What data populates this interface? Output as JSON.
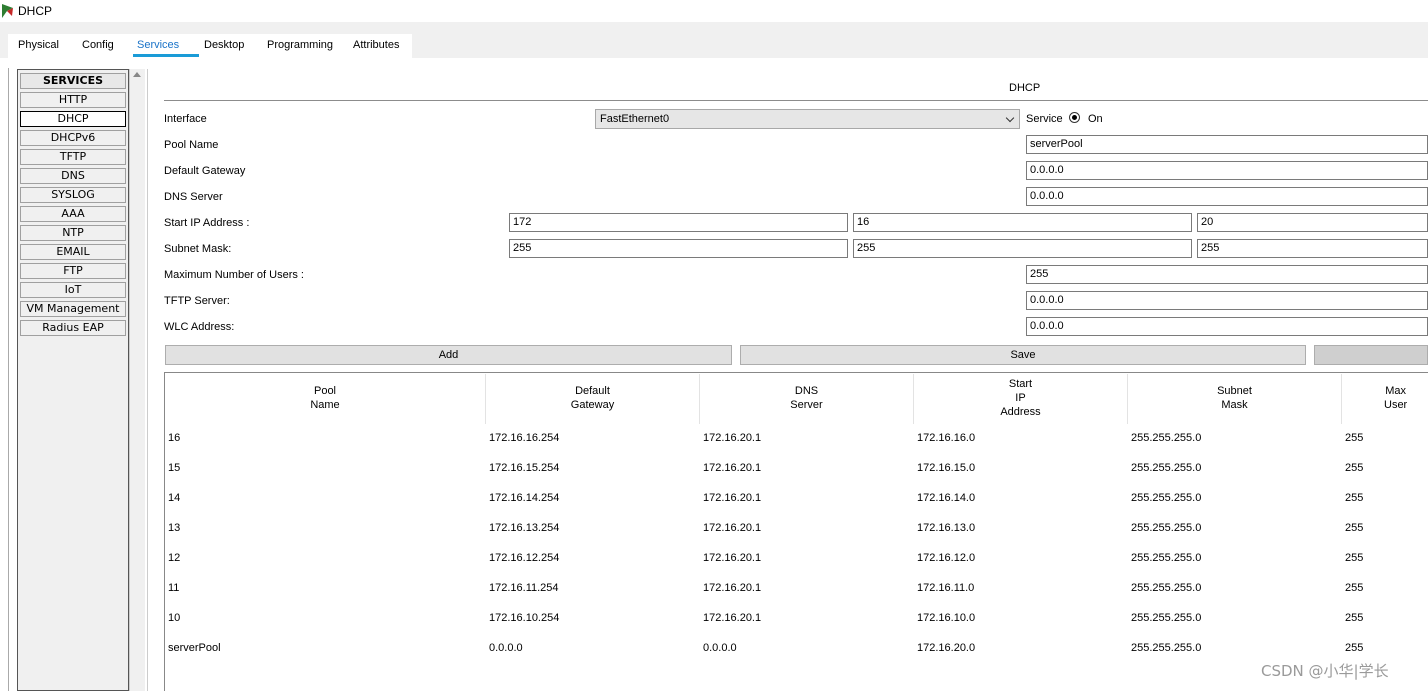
{
  "window": {
    "title": "DHCP"
  },
  "tabs": [
    "Physical",
    "Config",
    "Services",
    "Desktop",
    "Programming",
    "Attributes"
  ],
  "active_tab": "Services",
  "services": {
    "header": "SERVICES",
    "items": [
      "HTTP",
      "DHCP",
      "DHCPv6",
      "TFTP",
      "DNS",
      "SYSLOG",
      "AAA",
      "NTP",
      "EMAIL",
      "FTP",
      "IoT",
      "VM Management",
      "Radius EAP"
    ],
    "active": "DHCP"
  },
  "dhcp": {
    "title": "DHCP",
    "interface_label": "Interface",
    "interface_value": "FastEthernet0",
    "service_label": "Service",
    "service_on_label": "On",
    "pool_name_label": "Pool Name",
    "pool_name_value": "serverPool",
    "default_gateway_label": "Default Gateway",
    "default_gateway_value": "0.0.0.0",
    "dns_server_label": "DNS Server",
    "dns_server_value": "0.0.0.0",
    "start_ip_label": "Start IP Address :",
    "start_ip_octets": [
      "172",
      "16",
      "20"
    ],
    "subnet_mask_label": "Subnet Mask:",
    "subnet_mask_octets": [
      "255",
      "255",
      "255"
    ],
    "max_users_label": "Maximum Number of Users :",
    "max_users_value": "255",
    "tftp_label": "TFTP Server:",
    "tftp_value": "0.0.0.0",
    "wlc_label": "WLC Address:",
    "wlc_value": "0.0.0.0",
    "add_button": "Add",
    "save_button": "Save"
  },
  "table": {
    "headers": [
      [
        "Pool",
        "Name"
      ],
      [
        "Default",
        "Gateway"
      ],
      [
        "DNS",
        "Server"
      ],
      [
        "Start",
        "IP",
        "Address"
      ],
      [
        "Subnet",
        "Mask"
      ],
      [
        "Max",
        "User"
      ]
    ],
    "rows": [
      [
        "16",
        "172.16.16.254",
        "172.16.20.1",
        "172.16.16.0",
        "255.255.255.0",
        "255"
      ],
      [
        "15",
        "172.16.15.254",
        "172.16.20.1",
        "172.16.15.0",
        "255.255.255.0",
        "255"
      ],
      [
        "14",
        "172.16.14.254",
        "172.16.20.1",
        "172.16.14.0",
        "255.255.255.0",
        "255"
      ],
      [
        "13",
        "172.16.13.254",
        "172.16.20.1",
        "172.16.13.0",
        "255.255.255.0",
        "255"
      ],
      [
        "12",
        "172.16.12.254",
        "172.16.20.1",
        "172.16.12.0",
        "255.255.255.0",
        "255"
      ],
      [
        "11",
        "172.16.11.254",
        "172.16.20.1",
        "172.16.11.0",
        "255.255.255.0",
        "255"
      ],
      [
        "10",
        "172.16.10.254",
        "172.16.20.1",
        "172.16.10.0",
        "255.255.255.0",
        "255"
      ],
      [
        "serverPool",
        "0.0.0.0",
        "0.0.0.0",
        "172.16.20.0",
        "255.255.255.0",
        "255"
      ]
    ]
  },
  "watermark": "CSDN @小华|学长"
}
